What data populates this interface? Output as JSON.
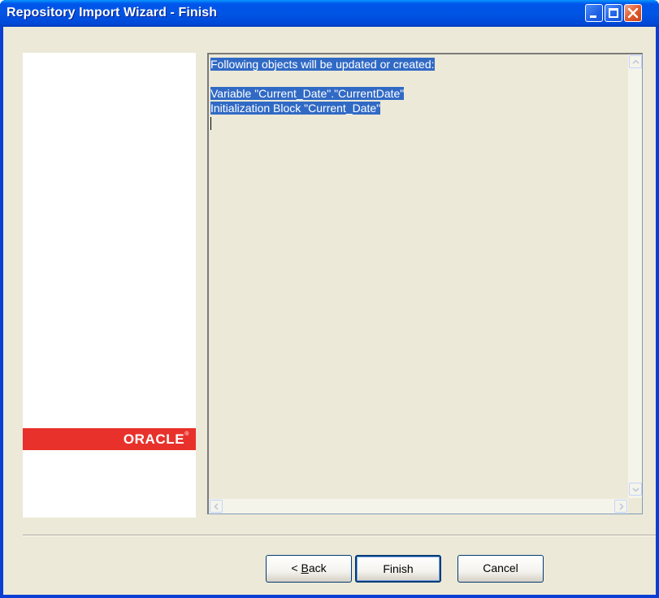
{
  "window": {
    "title": "Repository Import Wizard - Finish"
  },
  "logo": {
    "text": "ORACLE",
    "mark": "®",
    "color": "#e8312b"
  },
  "summary": {
    "lines": [
      "Following objects will be updated or created:",
      "",
      "Variable \"Current_Date\".\"CurrentDate\"",
      "Initialization Block \"Current_Date\""
    ],
    "selection_color": "#316ac5"
  },
  "buttons": {
    "back": {
      "prefix": "< ",
      "mnemonic": "B",
      "suffix": "ack"
    },
    "finish": "Finish",
    "cancel": "Cancel"
  },
  "icons": {
    "minimize": "minimize-icon",
    "maximize": "maximize-icon",
    "close": "close-icon",
    "scroll_up": "chevron-up-icon",
    "scroll_down": "chevron-down-icon",
    "scroll_left": "chevron-left-icon",
    "scroll_right": "chevron-right-icon"
  }
}
